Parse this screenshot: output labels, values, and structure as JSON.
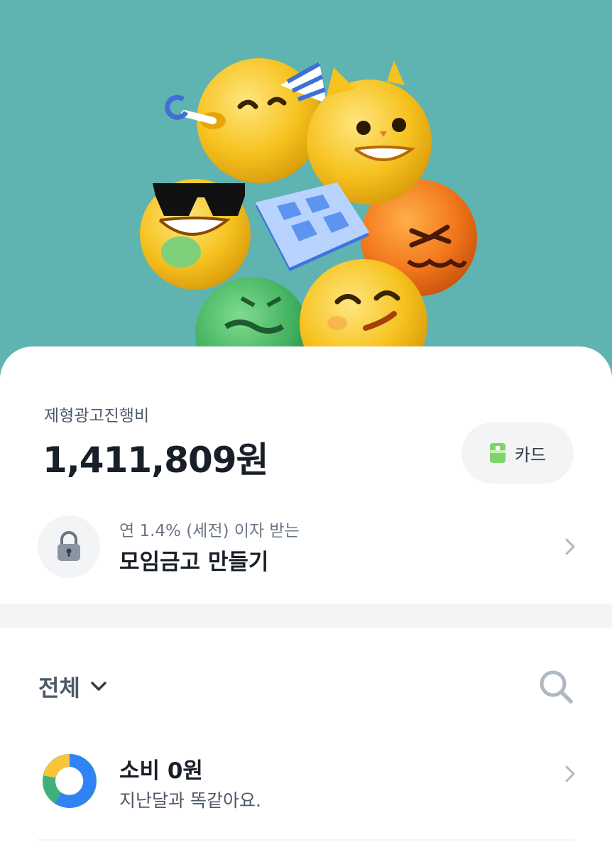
{
  "account": {
    "name": "제형광고진행비",
    "balance": "1,411,809원",
    "card_button_label": "카드"
  },
  "promo": {
    "subtitle": "연 1.4% (세전) 이자 받는",
    "title": "모임금고 만들기"
  },
  "filter": {
    "label": "전체"
  },
  "spending": {
    "title": "소비 0원",
    "subtitle": "지난달과 똑같아요."
  },
  "colors": {
    "hero_bg": "#5fb3b0",
    "donut_blue": "#3182f6",
    "donut_green": "#3fb07a",
    "donut_yellow": "#f9c33c",
    "card_icon": "#7dd46a"
  },
  "icons": {
    "lock": "lock-icon",
    "search": "search-icon",
    "chevron": "chevron-right-icon",
    "filter_chevron": "chevron-down-icon",
    "card": "card-icon"
  }
}
